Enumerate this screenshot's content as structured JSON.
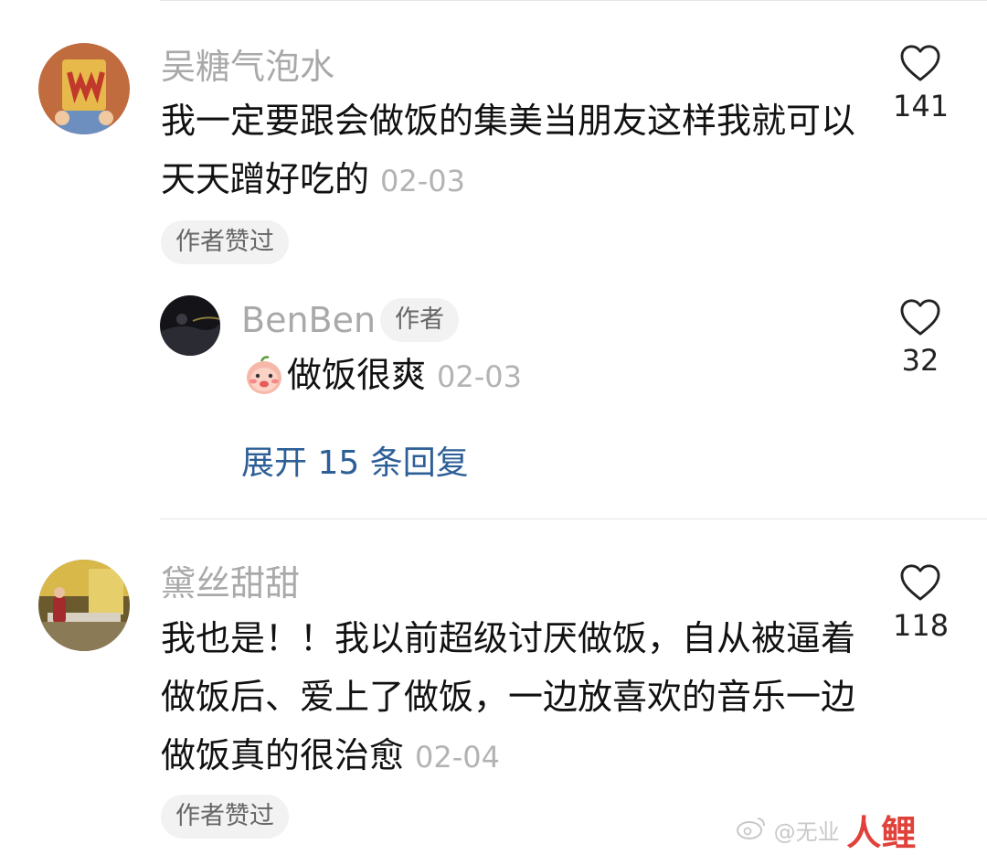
{
  "comments": [
    {
      "username": "吴糖气泡水",
      "text": "我一定要跟会做饭的集美当朋友这样我就可以天天蹭好吃的",
      "date": "02-03",
      "likes": "141",
      "badge": "作者赞过",
      "reply": {
        "username": "BenBen",
        "author_tag": "作者",
        "text": "做饭很爽",
        "date": "02-03",
        "likes": "32"
      },
      "expand_label": "展开 15 条回复"
    },
    {
      "username": "黛丝甜甜",
      "text": "我也是！！我以前超级讨厌做饭，自从被逼着做饭后、爱上了做饭，一边放喜欢的音乐一边做饭真的很治愈",
      "date": "02-04",
      "likes": "118",
      "badge": "作者赞过"
    }
  ],
  "watermark": {
    "text": "@无业",
    "brand": "人鲤"
  },
  "colors": {
    "username": "#a9a9a9",
    "date": "#b3b3b3",
    "link": "#2d5f97",
    "badge_bg": "#f2f2f2"
  }
}
